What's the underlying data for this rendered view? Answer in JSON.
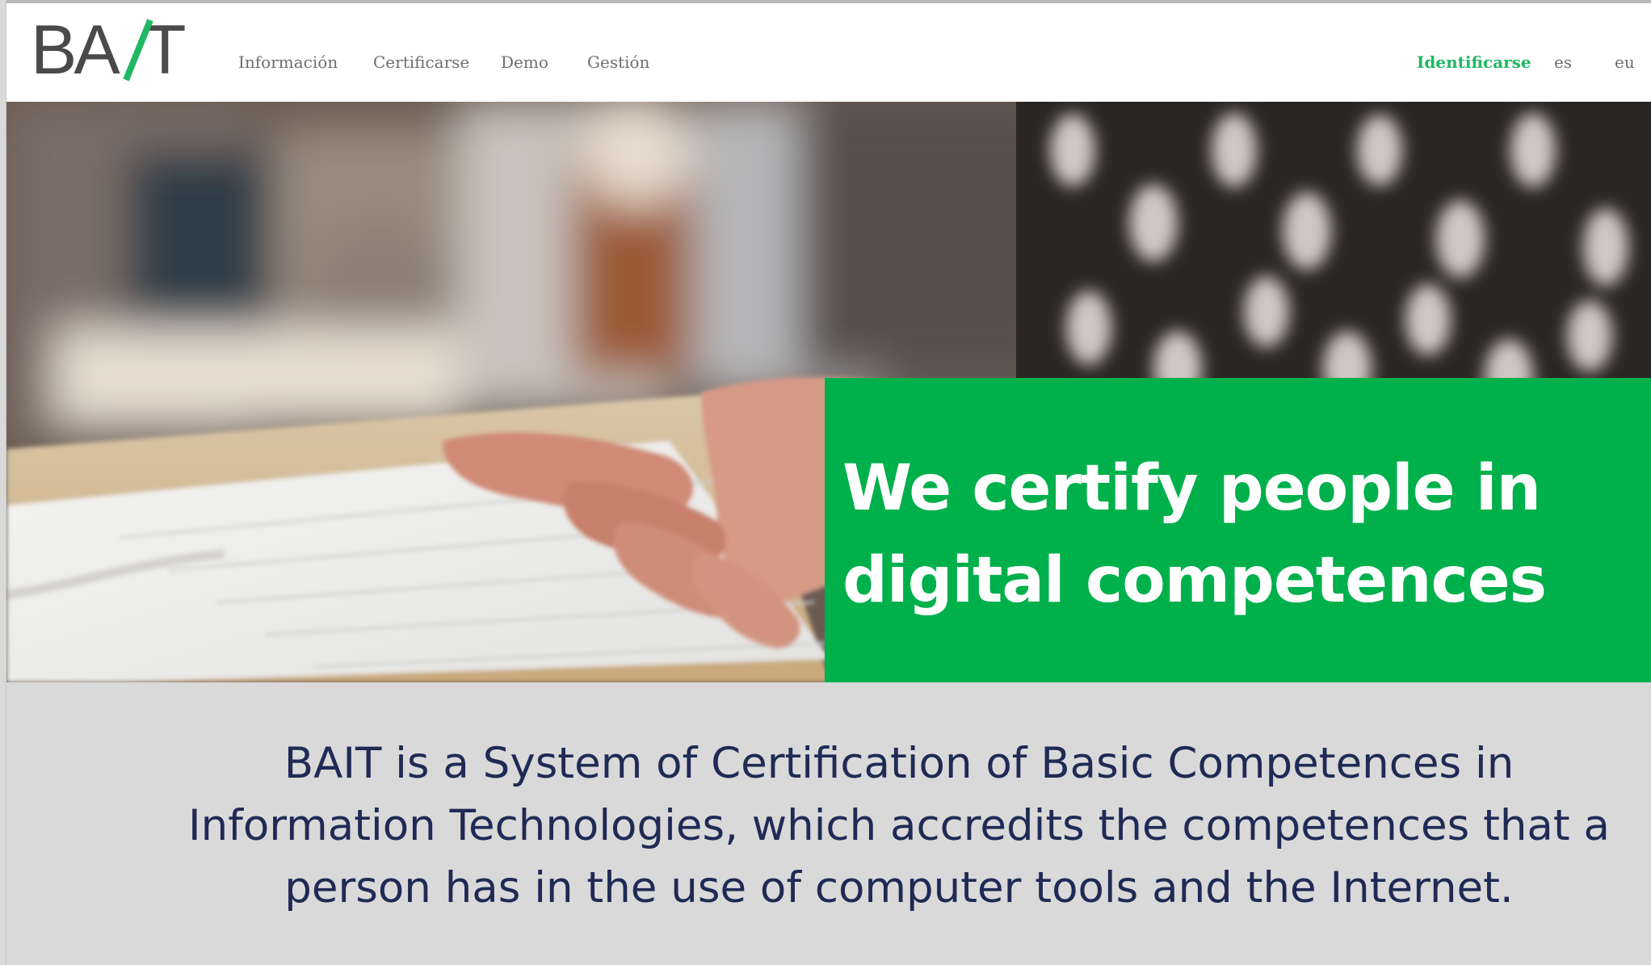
{
  "header": {
    "logo_text": "BAIT",
    "nav": [
      {
        "label": "Información"
      },
      {
        "label": "Certificarse"
      },
      {
        "label": "Demo"
      },
      {
        "label": "Gestión"
      }
    ],
    "login_label": "Identificarse",
    "languages": [
      "es",
      "eu"
    ]
  },
  "hero": {
    "title": "We certify people in digital competences",
    "image_alt": "hands-typing-on-keyboard-photo"
  },
  "description": {
    "text": "BAIT is a System of Certification of Basic Competences in Information Technologies, which accredits the competences that a person has in the use of computer tools and the Internet."
  },
  "colors": {
    "brand_green": "#00b04b",
    "login_green": "#20b864",
    "description_bg": "#d9d9d9",
    "description_text": "#1f2a55",
    "logo_gray": "#4a4a4a"
  }
}
